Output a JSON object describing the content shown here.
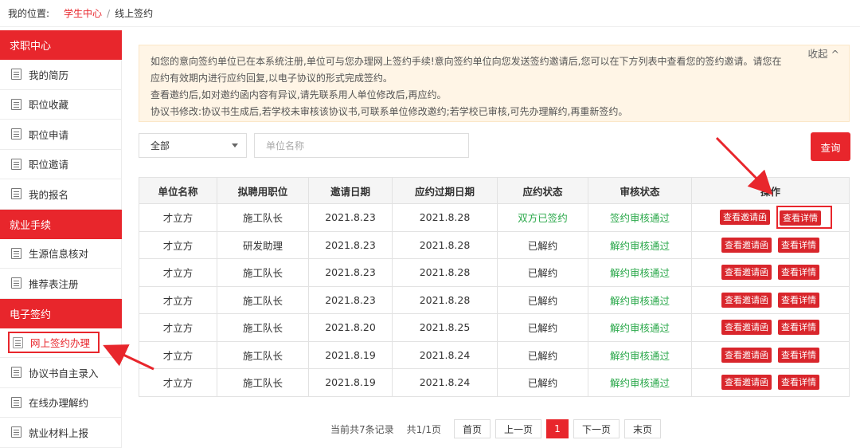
{
  "breadcrumb": {
    "prefix": "我的位置:",
    "home": "学生中心",
    "separator": "/",
    "current": "线上签约"
  },
  "sidebar": {
    "groups": [
      {
        "title": "求职中心",
        "items": [
          "我的简历",
          "职位收藏",
          "职位申请",
          "职位邀请",
          "我的报名"
        ]
      },
      {
        "title": "就业手续",
        "items": [
          "生源信息核对",
          "推荐表注册"
        ]
      },
      {
        "title": "电子签约",
        "items": [
          "网上签约办理",
          "协议书自主录入",
          "在线办理解约",
          "就业材料上报"
        ]
      }
    ]
  },
  "notice": {
    "lines": [
      "如您的意向签约单位已在本系统注册,单位可与您办理网上签约手续!意向签约单位向您发送签约邀请后,您可以在下方列表中查看您的签约邀请。请您在应约有效期内进行应约回复,以电子协议的形式完成签约。",
      "查看邀约后,如对邀约函内容有异议,请先联系用人单位修改后,再应约。",
      "协议书修改:协议书生成后,若学校未审核该协议书,可联系单位修改邀约;若学校已审核,可先办理解约,再重新签约。"
    ],
    "collapse_label": "收起 ^"
  },
  "search": {
    "select_value": "全部",
    "input_placeholder": "单位名称",
    "query_label": "查询"
  },
  "table": {
    "headers": [
      "单位名称",
      "拟聘用职位",
      "邀请日期",
      "应约过期日期",
      "应约状态",
      "审核状态",
      "操作"
    ],
    "rows": [
      {
        "company": "才立方",
        "position": "施工队长",
        "invite_date": "2021.8.23",
        "expire_date": "2021.8.28",
        "status": "双方已签约",
        "review": "签约审核通过"
      },
      {
        "company": "才立方",
        "position": "研发助理",
        "invite_date": "2021.8.23",
        "expire_date": "2021.8.28",
        "status": "已解约",
        "review": "解约审核通过"
      },
      {
        "company": "才立方",
        "position": "施工队长",
        "invite_date": "2021.8.23",
        "expire_date": "2021.8.28",
        "status": "已解约",
        "review": "解约审核通过"
      },
      {
        "company": "才立方",
        "position": "施工队长",
        "invite_date": "2021.8.23",
        "expire_date": "2021.8.28",
        "status": "已解约",
        "review": "解约审核通过"
      },
      {
        "company": "才立方",
        "position": "施工队长",
        "invite_date": "2021.8.20",
        "expire_date": "2021.8.25",
        "status": "已解约",
        "review": "解约审核通过"
      },
      {
        "company": "才立方",
        "position": "施工队长",
        "invite_date": "2021.8.19",
        "expire_date": "2021.8.24",
        "status": "已解约",
        "review": "解约审核通过"
      },
      {
        "company": "才立方",
        "position": "施工队长",
        "invite_date": "2021.8.19",
        "expire_date": "2021.8.24",
        "status": "已解约",
        "review": "解约审核通过"
      }
    ],
    "op_view_invite": "查看邀请函",
    "op_view_detail": "查看详情"
  },
  "pager": {
    "summary": "当前共7条记录",
    "pages": "共1/1页",
    "first": "首页",
    "prev": "上一页",
    "current": "1",
    "next": "下一页",
    "last": "末页"
  },
  "colors": {
    "accent": "#e8262c",
    "notice_bg": "#fff5e6",
    "success": "#2aa84a"
  }
}
